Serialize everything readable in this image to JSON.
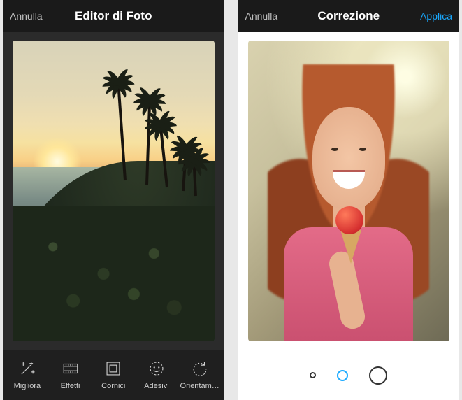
{
  "left": {
    "header": {
      "cancel": "Annulla",
      "title": "Editor di Foto"
    },
    "tools": [
      {
        "id": "enhance",
        "label": "Migliora",
        "icon": "magic-wand-icon"
      },
      {
        "id": "effects",
        "label": "Effetti",
        "icon": "filmstrip-icon"
      },
      {
        "id": "frames",
        "label": "Cornici",
        "icon": "frame-icon"
      },
      {
        "id": "stickers",
        "label": "Adesivi",
        "icon": "sticker-icon"
      },
      {
        "id": "orient",
        "label": "Orientam…",
        "icon": "rotate-icon"
      }
    ]
  },
  "right": {
    "header": {
      "cancel": "Annulla",
      "title": "Correzione",
      "apply": "Applica"
    },
    "sizes": {
      "options": [
        "small",
        "medium",
        "large"
      ],
      "selected": "medium",
      "accent": "#19a9ff"
    }
  }
}
